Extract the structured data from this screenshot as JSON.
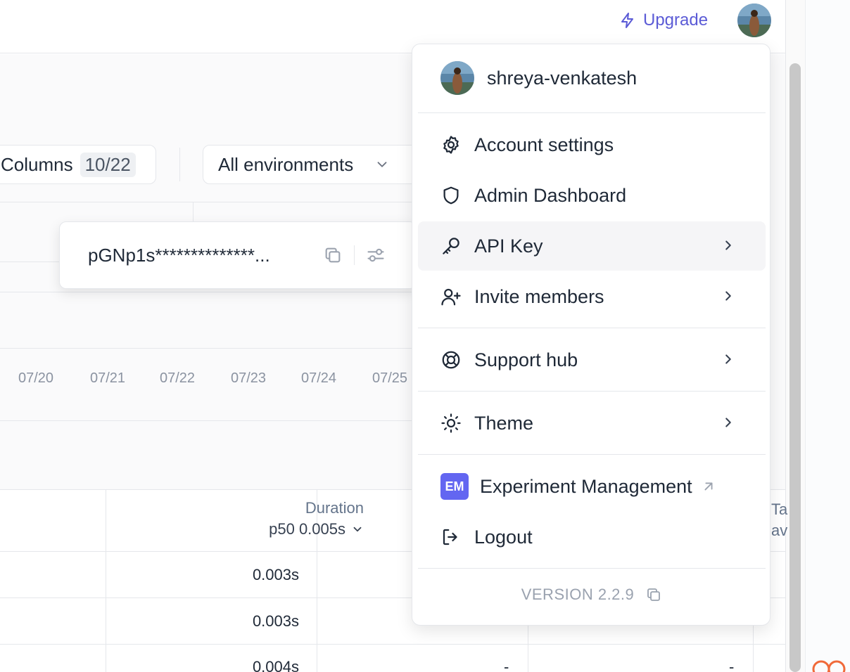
{
  "header": {
    "upgrade_label": "Upgrade",
    "upgrade_icon": "lightning-icon"
  },
  "toolbar": {
    "columns_label": "Columns",
    "columns_count": "10/22",
    "environment_selected": "All environments"
  },
  "chart": {
    "date_ticks": [
      "07/20",
      "07/21",
      "07/22",
      "07/23",
      "07/24",
      "07/25"
    ]
  },
  "table": {
    "duration_header": "Duration",
    "duration_summary": "p50 0.005s",
    "partial_header_line1": "Ta",
    "partial_header_line2": "av",
    "rows": [
      {
        "duration": "0.003s"
      },
      {
        "duration": "0.003s"
      },
      {
        "duration": "0.004s",
        "c3": "-",
        "c4": "-"
      }
    ]
  },
  "api_key_popover": {
    "masked_key": "pGNp1s**************..."
  },
  "user_menu": {
    "username": "shreya-venkatesh",
    "items": [
      {
        "label": "Account settings",
        "icon": "gear-icon"
      },
      {
        "label": "Admin Dashboard",
        "icon": "shield-icon"
      },
      {
        "label": "API Key",
        "icon": "key-icon"
      },
      {
        "label": "Invite members",
        "icon": "user-plus-icon"
      },
      {
        "label": "Support hub",
        "icon": "lifebuoy-icon"
      },
      {
        "label": "Theme",
        "icon": "sun-icon"
      },
      {
        "label": "Experiment Management",
        "icon": "external-link-icon",
        "badge": "EM"
      },
      {
        "label": "Logout",
        "icon": "logout-icon"
      }
    ],
    "version": "VERSION 2.2.9"
  },
  "colors": {
    "accent": "#5b5bd6",
    "em_badge": "#6366f1"
  }
}
